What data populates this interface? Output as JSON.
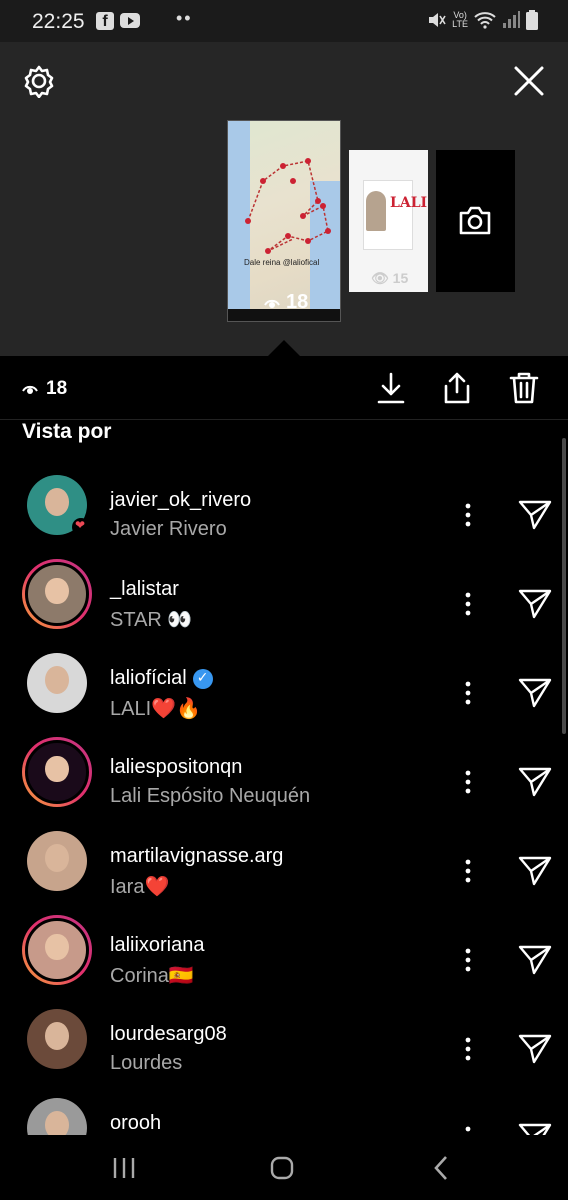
{
  "status_bar": {
    "time": "22:25",
    "icons": [
      "facebook-icon",
      "youtube-icon",
      "mute-icon",
      "volte-icon",
      "wifi-icon",
      "signal-icon",
      "battery-icon"
    ],
    "volte_label": "Vo)) LTE"
  },
  "story_panel": {
    "main_story": {
      "caption": "Dale reina @laliofical",
      "views": "18"
    },
    "second_story": {
      "poster_title": "LALI",
      "views": "15"
    }
  },
  "action_row": {
    "views": "18"
  },
  "section_title": "Vista por",
  "viewers": [
    {
      "username": "javier_ok_rivero",
      "fullname": "Javier Rivero",
      "verified": false,
      "ring": false,
      "liked": true,
      "avatar_color": "#2f8f85"
    },
    {
      "username": "_lalistar",
      "fullname": "STAR 👀",
      "verified": false,
      "ring": true,
      "liked": false,
      "avatar_color": "#8d7a6a"
    },
    {
      "username": "laliofícial",
      "fullname": "LALI❤️🔥",
      "verified": true,
      "ring": false,
      "liked": false,
      "avatar_color": "#d8d8d8"
    },
    {
      "username": "laliespositonqn",
      "fullname": "Lali Espósito Neuquén",
      "verified": false,
      "ring": true,
      "liked": false,
      "avatar_color": "#1a0a1a"
    },
    {
      "username": "martilavignasse.arg",
      "fullname": "Iara❤️",
      "verified": false,
      "ring": false,
      "liked": false,
      "avatar_color": "#c7a48c"
    },
    {
      "username": "laliixoriana",
      "fullname": "Corina🇪🇸",
      "verified": false,
      "ring": true,
      "liked": false,
      "avatar_color": "#c79a8a"
    },
    {
      "username": "lourdesarg08",
      "fullname": "Lourdes",
      "verified": false,
      "ring": false,
      "liked": false,
      "avatar_color": "#6b4a3a"
    },
    {
      "username": "orooh",
      "fullname": "",
      "verified": false,
      "ring": false,
      "liked": false,
      "avatar_color": "#9a9a9a"
    }
  ],
  "colors": {
    "panel_bg": "#262626",
    "background": "#000000",
    "secondary_text": "#a8a8a8",
    "verified_blue": "#3897f0",
    "like_red": "#ed4956"
  }
}
